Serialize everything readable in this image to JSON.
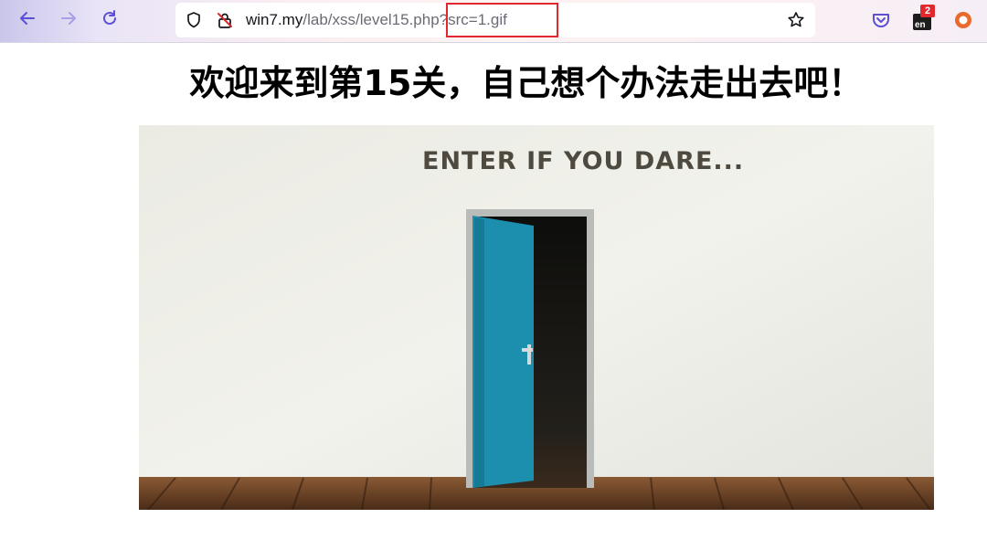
{
  "browser": {
    "url_host": "win7.my",
    "url_path": "/lab/xss/level15.php?src=1.gif",
    "extension_badge_count": "2",
    "extension_label": "en",
    "icons": [
      "back-icon",
      "forward-icon",
      "reload-icon",
      "shield-icon",
      "insecure-lock-icon",
      "bookmark-star-icon",
      "pocket-icon",
      "language-extension-icon",
      "ublock-extension-icon"
    ],
    "highlight_color": "#e0282e"
  },
  "page": {
    "heading": "欢迎来到第15关，自己想个办法走出去吧！",
    "image_caption": "ENTER IF YOU DARE..."
  }
}
